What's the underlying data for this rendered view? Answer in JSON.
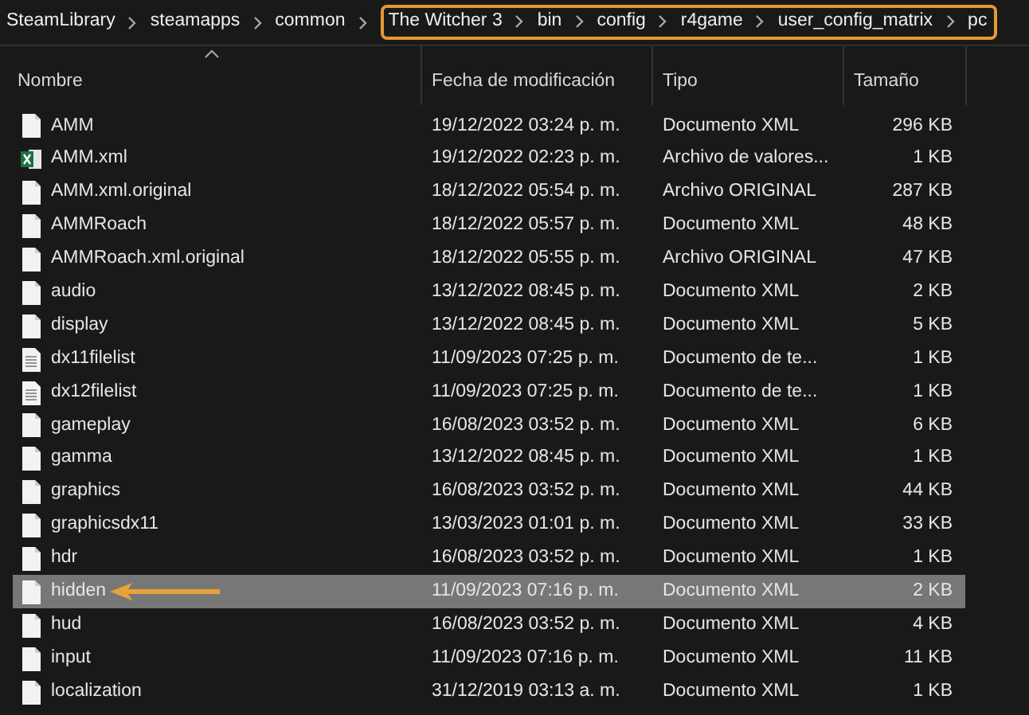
{
  "breadcrumb": [
    "SteamLibrary",
    "steamapps",
    "common"
  ],
  "highlighted_path": [
    "The Witcher 3",
    "bin",
    "config",
    "r4game",
    "user_config_matrix",
    "pc"
  ],
  "columns": [
    {
      "label": "Nombre",
      "sorted": true
    },
    {
      "label": "Fecha de modificación",
      "sorted": false
    },
    {
      "label": "Tipo",
      "sorted": false
    },
    {
      "label": "Tamaño",
      "sorted": false
    }
  ],
  "files": [
    {
      "kind": "file",
      "name": "AMM",
      "date": "19/12/2022 03:24 p. m.",
      "type": "Documento XML",
      "size": "296 KB",
      "selected": false,
      "arrow": false
    },
    {
      "kind": "excel",
      "name": "AMM.xml",
      "date": "19/12/2022 02:23 p. m.",
      "type": "Archivo de valores...",
      "size": "1 KB",
      "selected": false,
      "arrow": false
    },
    {
      "kind": "file",
      "name": "AMM.xml.original",
      "date": "18/12/2022 05:54 p. m.",
      "type": "Archivo ORIGINAL",
      "size": "287 KB",
      "selected": false,
      "arrow": false
    },
    {
      "kind": "file",
      "name": "AMMRoach",
      "date": "18/12/2022 05:57 p. m.",
      "type": "Documento XML",
      "size": "48 KB",
      "selected": false,
      "arrow": false
    },
    {
      "kind": "file",
      "name": "AMMRoach.xml.original",
      "date": "18/12/2022 05:55 p. m.",
      "type": "Archivo ORIGINAL",
      "size": "47 KB",
      "selected": false,
      "arrow": false
    },
    {
      "kind": "file",
      "name": "audio",
      "date": "13/12/2022 08:45 p. m.",
      "type": "Documento XML",
      "size": "2 KB",
      "selected": false,
      "arrow": false
    },
    {
      "kind": "file",
      "name": "display",
      "date": "13/12/2022 08:45 p. m.",
      "type": "Documento XML",
      "size": "5 KB",
      "selected": false,
      "arrow": false
    },
    {
      "kind": "text",
      "name": "dx11filelist",
      "date": "11/09/2023 07:25 p. m.",
      "type": "Documento de te...",
      "size": "1 KB",
      "selected": false,
      "arrow": false
    },
    {
      "kind": "text",
      "name": "dx12filelist",
      "date": "11/09/2023 07:25 p. m.",
      "type": "Documento de te...",
      "size": "1 KB",
      "selected": false,
      "arrow": false
    },
    {
      "kind": "file",
      "name": "gameplay",
      "date": "16/08/2023 03:52 p. m.",
      "type": "Documento XML",
      "size": "6 KB",
      "selected": false,
      "arrow": false
    },
    {
      "kind": "file",
      "name": "gamma",
      "date": "13/12/2022 08:45 p. m.",
      "type": "Documento XML",
      "size": "1 KB",
      "selected": false,
      "arrow": false
    },
    {
      "kind": "file",
      "name": "graphics",
      "date": "16/08/2023 03:52 p. m.",
      "type": "Documento XML",
      "size": "44 KB",
      "selected": false,
      "arrow": false
    },
    {
      "kind": "file",
      "name": "graphicsdx11",
      "date": "13/03/2023 01:01 p. m.",
      "type": "Documento XML",
      "size": "33 KB",
      "selected": false,
      "arrow": false
    },
    {
      "kind": "file",
      "name": "hdr",
      "date": "16/08/2023 03:52 p. m.",
      "type": "Documento XML",
      "size": "1 KB",
      "selected": false,
      "arrow": false
    },
    {
      "kind": "file",
      "name": "hidden",
      "date": "11/09/2023 07:16 p. m.",
      "type": "Documento XML",
      "size": "2 KB",
      "selected": true,
      "arrow": true
    },
    {
      "kind": "file",
      "name": "hud",
      "date": "16/08/2023 03:52 p. m.",
      "type": "Documento XML",
      "size": "4 KB",
      "selected": false,
      "arrow": false
    },
    {
      "kind": "file",
      "name": "input",
      "date": "11/09/2023 07:16 p. m.",
      "type": "Documento XML",
      "size": "11 KB",
      "selected": false,
      "arrow": false
    },
    {
      "kind": "file",
      "name": "localization",
      "date": "31/12/2019 03:13 a. m.",
      "type": "Documento XML",
      "size": "1 KB",
      "selected": false,
      "arrow": false
    }
  ]
}
